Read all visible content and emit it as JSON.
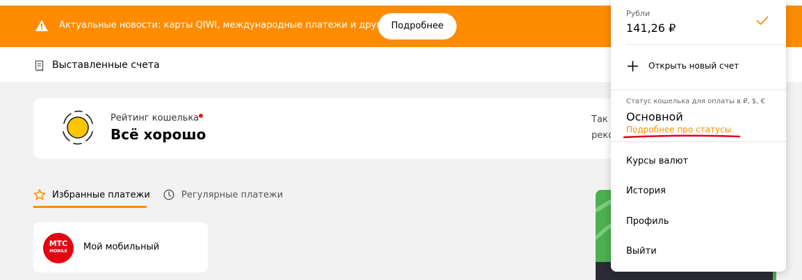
{
  "banner": {
    "text": "Актуальные новости: карты QIWI, международные платежи и другие темы",
    "button_label": "Подробнее"
  },
  "subnav": {
    "invoices_label": "Выставленные счета"
  },
  "rating": {
    "label": "Рейтинг кошелька",
    "value": "Всё хорошо",
    "side_text_1": "Так д",
    "side_text_2": "реко"
  },
  "tabs": [
    {
      "label": "Избранные платежи"
    },
    {
      "label": "Регулярные платежи"
    }
  ],
  "favorites": [
    {
      "logo_line1": "МТС",
      "logo_line2": "MOBILE",
      "label": "Мой мобильный"
    }
  ],
  "dropdown": {
    "currency_label": "Рубли",
    "balance": "141,26 ₽",
    "open_account_label": "Открыть новый счет",
    "status_label": "Статус кошелька для оплаты в ₽, $, €",
    "status_value": "Основной",
    "status_link": "Подробнее про статусы",
    "menu": [
      {
        "label": "Курсы валют"
      },
      {
        "label": "История"
      },
      {
        "label": "Профиль"
      },
      {
        "label": "Выйти"
      }
    ]
  },
  "colors": {
    "accent": "#ff8c00",
    "alert_dot": "#e02020",
    "mts_red": "#e30611",
    "annotation_underline": "#e0001a"
  },
  "icons": {
    "banner": "warning-icon",
    "subnav": "receipt-icon",
    "tab_fav": "star-icon",
    "tab_reg": "clock-icon",
    "balance_selected": "check-icon",
    "open_account": "plus-icon"
  }
}
